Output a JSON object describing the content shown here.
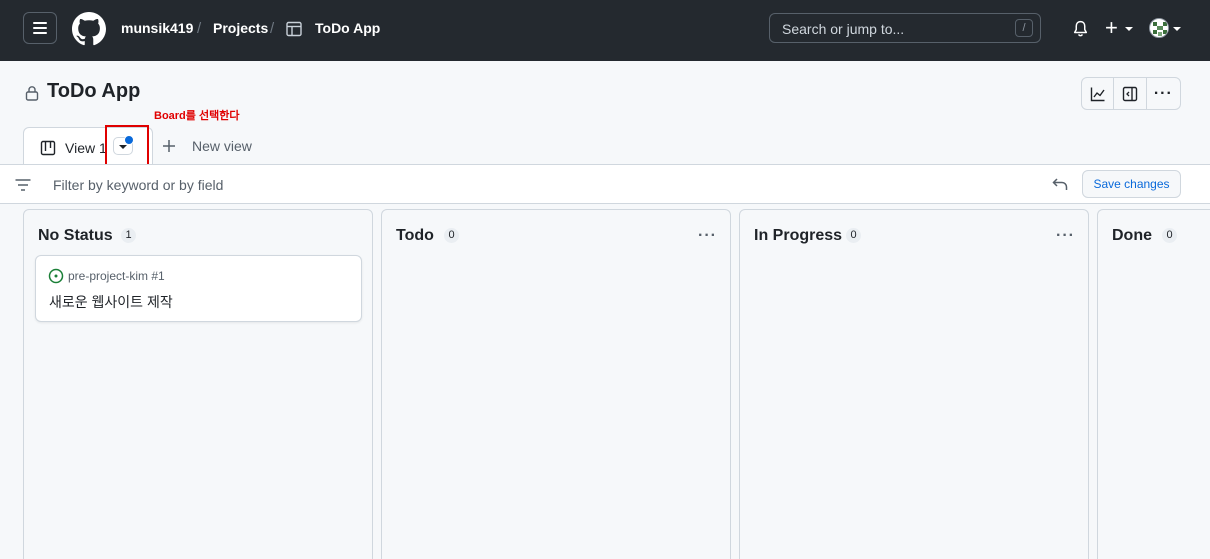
{
  "topnav": {
    "owner": "munsik419",
    "projects": "Projects",
    "project": "ToDo App",
    "search_placeholder": "Search or jump to...",
    "search_key": "/"
  },
  "header": {
    "title": "ToDo App",
    "annotation": "Board를 선택한다"
  },
  "tabs": {
    "active_label": "View 1",
    "new_view": "New view"
  },
  "filter": {
    "placeholder": "Filter by keyword or by field",
    "save_label": "Save changes"
  },
  "columns": [
    {
      "title": "No Status",
      "count": "1",
      "cards": [
        {
          "repo": "pre-project-kim #1",
          "title": "새로운 웹사이트 제작"
        }
      ]
    },
    {
      "title": "Todo",
      "count": "0",
      "cards": []
    },
    {
      "title": "In Progress",
      "count": "0",
      "cards": []
    },
    {
      "title": "Done",
      "count": "0",
      "cards": []
    }
  ],
  "colors": {
    "nav_bg": "#24292f",
    "accent": "#0969da",
    "annotation": "#e00000",
    "issue_open": "#1a7f37"
  },
  "icons": [
    "menu-icon",
    "github-logo",
    "project-table-icon",
    "bell-icon",
    "plus-icon",
    "lock-icon",
    "insights-icon",
    "side-panel-icon",
    "kebab-icon",
    "board-icon",
    "filter-icon",
    "undo-icon",
    "issue-open-icon"
  ]
}
